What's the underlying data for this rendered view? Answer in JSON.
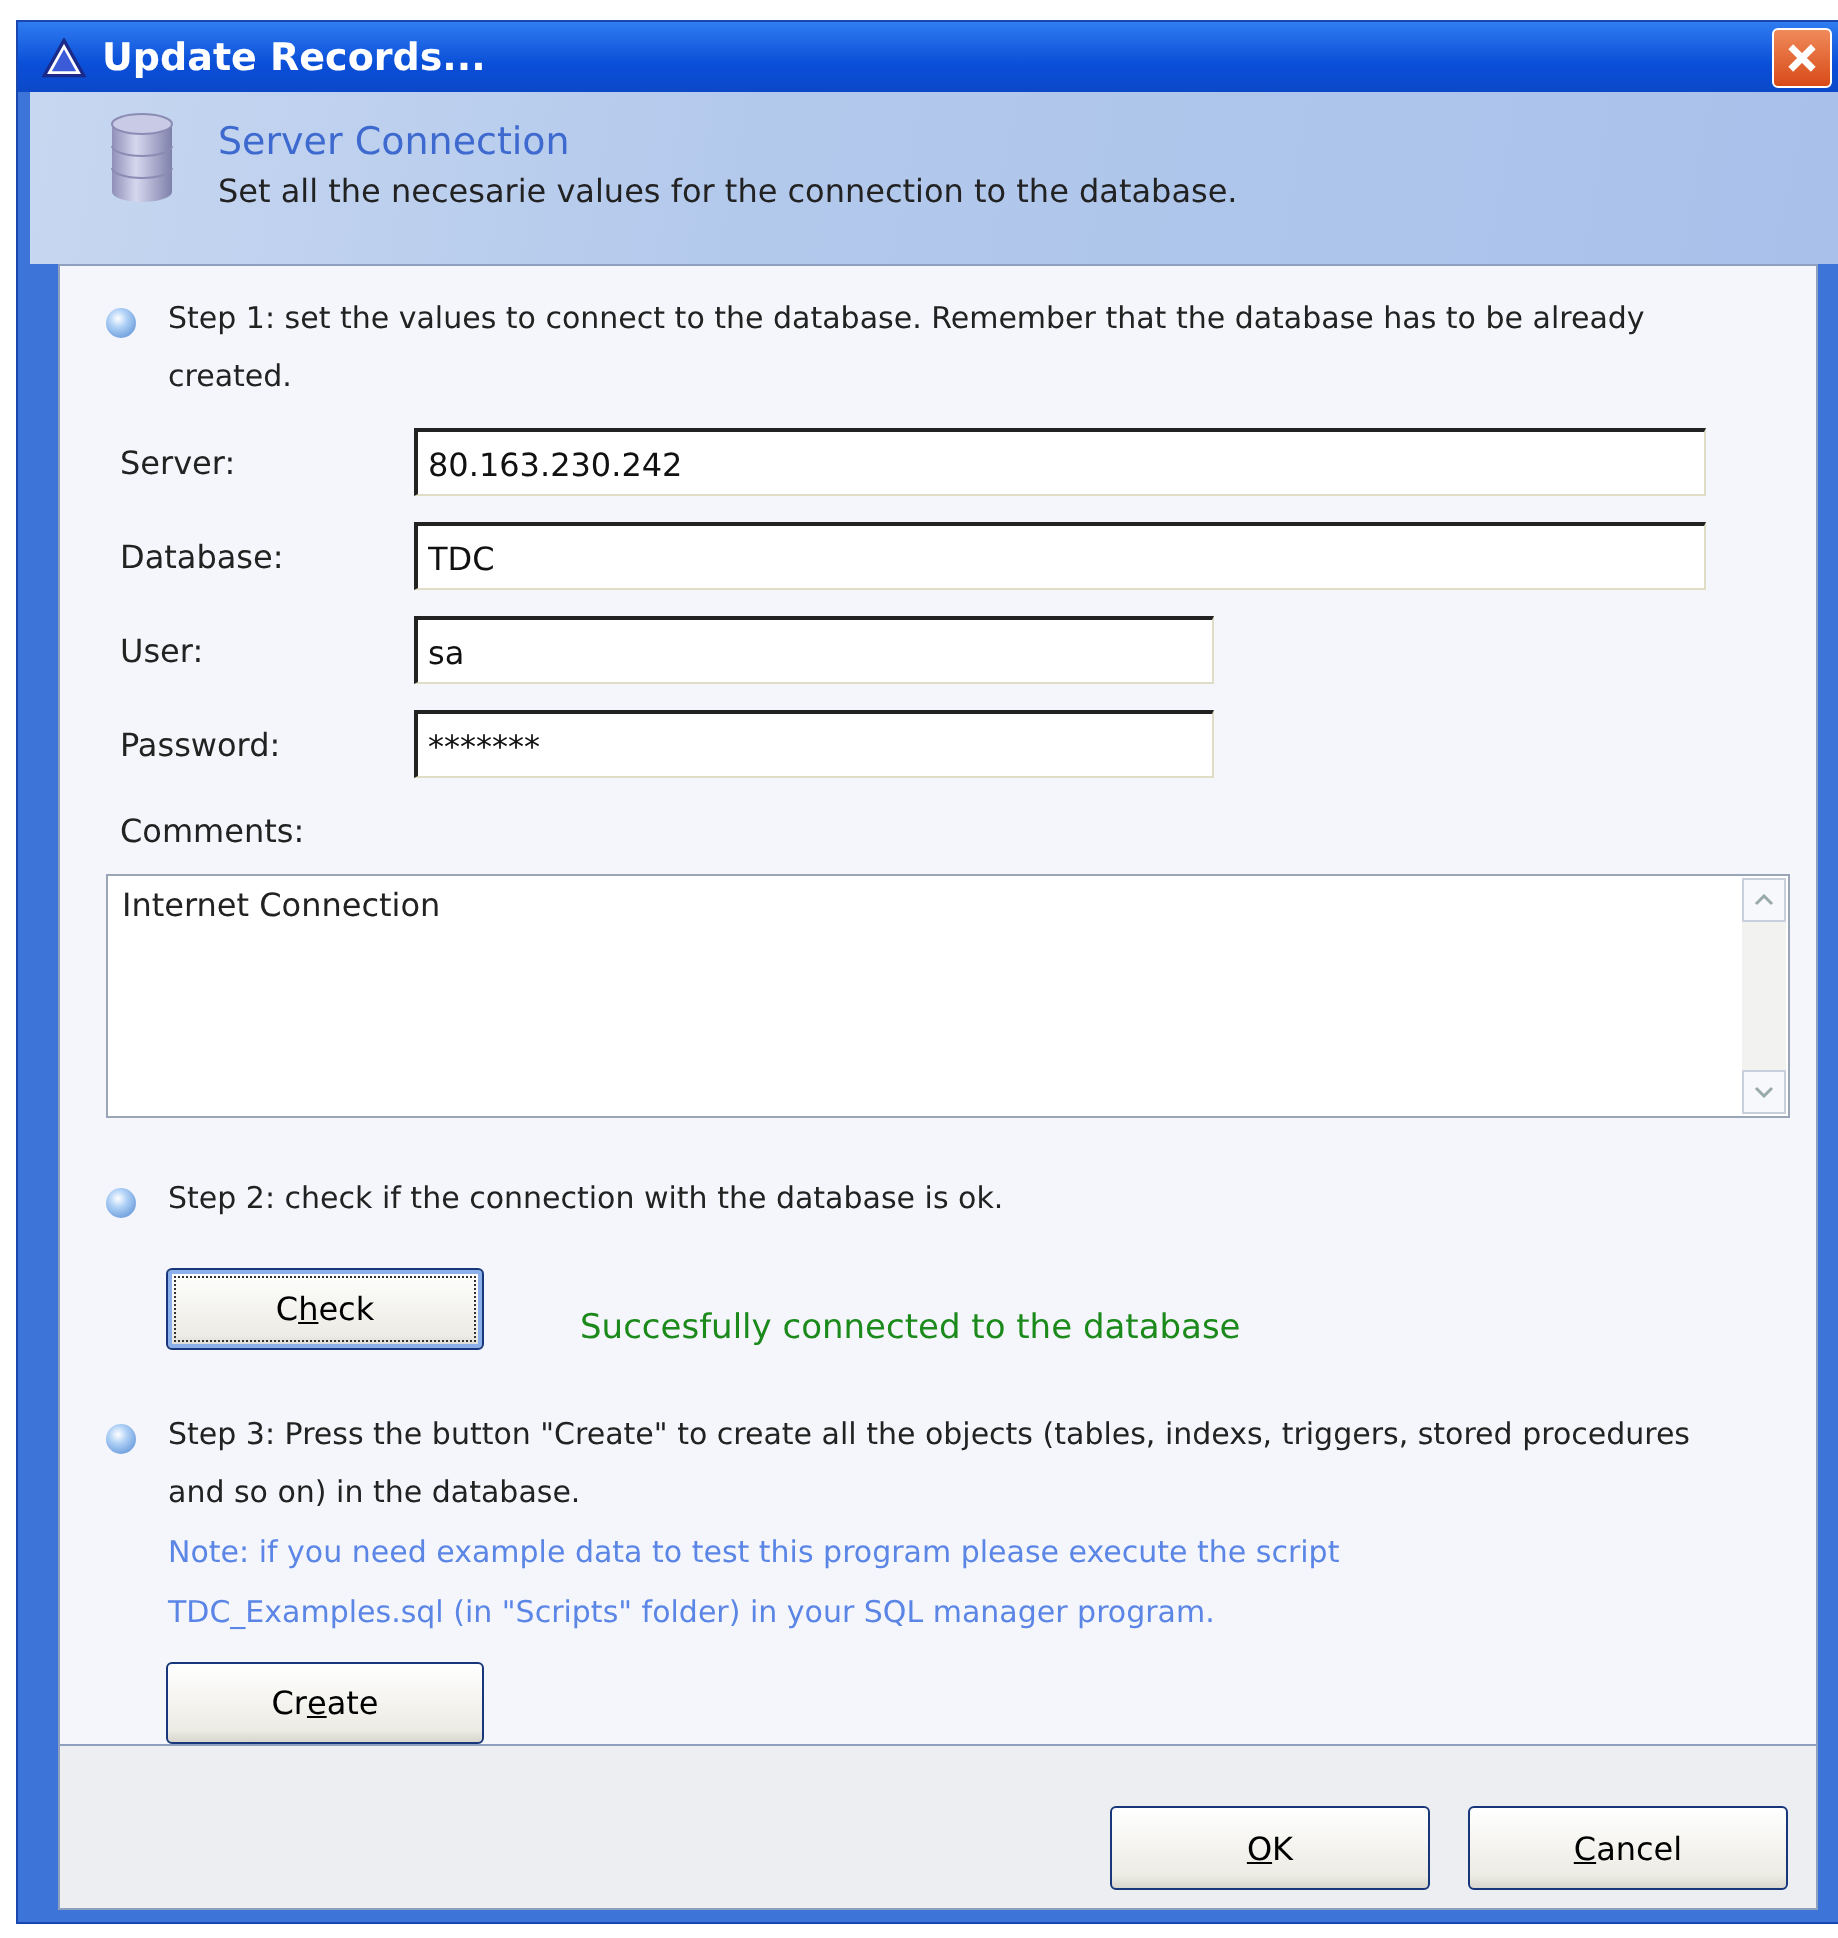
{
  "window": {
    "title": "Update Records..."
  },
  "header": {
    "title": "Server Connection",
    "subtitle": "Set all the necesarie values for the connection to the database."
  },
  "step1": {
    "text": "Step 1: set the values to connect to the database. Remember that the database has to be already created."
  },
  "fields": [
    {
      "label": "Server:",
      "value": "80.163.230.242",
      "kind": "wide"
    },
    {
      "label": "Database:",
      "value": "TDC",
      "kind": "wide"
    },
    {
      "label": "User:",
      "value": "sa",
      "kind": "narrow"
    },
    {
      "label": "Password:",
      "value": "*******",
      "kind": "narrow"
    }
  ],
  "comments": {
    "label": "Comments:",
    "value": "Internet Connection"
  },
  "step2": {
    "text": "Step 2: check if the connection with the database is ok.",
    "button": {
      "before": "C",
      "key": "h",
      "after": "eck",
      "focused": true
    },
    "status": "Succesfully connected to the database"
  },
  "step3": {
    "text": "Step 3: Press the button \"Create\" to create all the objects (tables, indexs, triggers, stored procedures and so on) in the database.",
    "note": "Note: if you need example data to test this program please execute the script TDC_Examples.sql (in \"Scripts\" folder) in your SQL manager program.",
    "button": {
      "before": "Cr",
      "key": "e",
      "after": "ate",
      "focused": false
    }
  },
  "footer_buttons": [
    {
      "key": "O",
      "after": "K",
      "focused": false
    },
    {
      "key": "C",
      "after": "ancel",
      "focused": false
    }
  ]
}
